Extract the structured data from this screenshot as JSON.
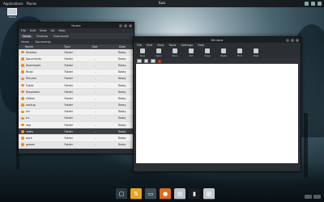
{
  "top_panel": {
    "clock": "Sun",
    "left_items": [
      "Applications",
      "Places"
    ],
    "right_status": [
      "",
      ""
    ]
  },
  "desktop_icon": {
    "label": "Home",
    "icon": "monitor-icon"
  },
  "file_manager": {
    "title": "Home",
    "menu": [
      "File",
      "Edit",
      "View",
      "Go",
      "Help"
    ],
    "tabs": [
      "Home",
      "Desktop",
      "Downloads"
    ],
    "path": [
      "Home",
      "Documents"
    ],
    "columns": [
      "Name",
      "Type",
      "Size",
      "Date"
    ],
    "rows": [
      {
        "name": "Desktop",
        "type": "Folder",
        "size": "-",
        "date": "Today"
      },
      {
        "name": "Documents",
        "type": "Folder",
        "size": "-",
        "date": "Today"
      },
      {
        "name": "Downloads",
        "type": "Folder",
        "size": "-",
        "date": "Today"
      },
      {
        "name": "Music",
        "type": "Folder",
        "size": "-",
        "date": "Today"
      },
      {
        "name": "Pictures",
        "type": "Folder",
        "size": "-",
        "date": "Today"
      },
      {
        "name": "Public",
        "type": "Folder",
        "size": "-",
        "date": "Today"
      },
      {
        "name": "Templates",
        "type": "Folder",
        "size": "-",
        "date": "Today"
      },
      {
        "name": "Videos",
        "type": "Folder",
        "size": "-",
        "date": "Today"
      },
      {
        "name": "backup",
        "type": "Folder",
        "size": "-",
        "date": "Today"
      },
      {
        "name": "bin",
        "type": "Folder",
        "size": "-",
        "date": "Today"
      },
      {
        "name": "src",
        "type": "Folder",
        "size": "-",
        "date": "Today"
      },
      {
        "name": "tmp",
        "type": "Folder",
        "size": "-",
        "date": "Today"
      },
      {
        "name": "notes",
        "type": "Folder",
        "size": "-",
        "date": "Today"
      },
      {
        "name": "work",
        "type": "Folder",
        "size": "-",
        "date": "Today"
      },
      {
        "name": "games",
        "type": "Folder",
        "size": "-",
        "date": "Today"
      }
    ]
  },
  "app_window": {
    "title": "Window",
    "menu": [
      "File",
      "Edit",
      "View",
      "Tools",
      "Settings",
      "Help"
    ],
    "toolbar": [
      {
        "label": "New",
        "icon": "new-icon"
      },
      {
        "label": "Open",
        "icon": "open-icon"
      },
      {
        "label": "Save",
        "icon": "save-icon"
      },
      {
        "label": "Cut",
        "icon": "cut-icon"
      },
      {
        "label": "Copy",
        "icon": "copy-icon"
      },
      {
        "label": "Paste",
        "icon": "paste-icon"
      },
      {
        "label": "Find",
        "icon": "find-icon"
      },
      {
        "label": "Help",
        "icon": "help-icon"
      }
    ],
    "status": [
      "",
      "",
      ""
    ]
  },
  "dock": [
    {
      "name": "desktop-app",
      "glyph": "▢",
      "color": "#2b3a44"
    },
    {
      "name": "transfer-app",
      "glyph": "⇅",
      "color": "#e8a41c"
    },
    {
      "name": "terminal-window-app",
      "glyph": "▭",
      "color": "#3d4d58"
    },
    {
      "name": "firefox-app",
      "glyph": "●",
      "color": "#e06a1a"
    },
    {
      "name": "files-app",
      "glyph": "▤",
      "color": "#b9c0c6"
    },
    {
      "name": "terminal-app",
      "glyph": "▮",
      "color": "#1a1d20"
    },
    {
      "name": "archive-app",
      "glyph": "▥",
      "color": "#c4c8cc"
    }
  ]
}
